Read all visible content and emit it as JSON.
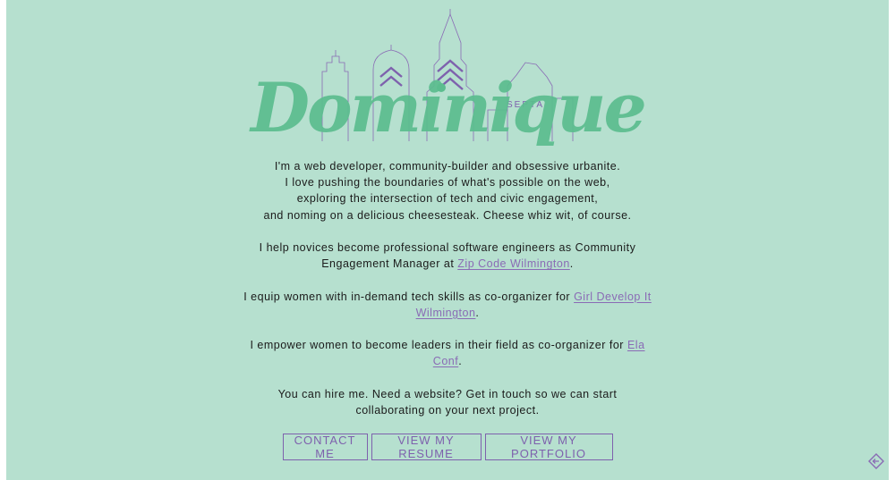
{
  "hero": {
    "title": "Dominique",
    "skyline_sign": "SEPTA"
  },
  "intro": {
    "lines": [
      "I'm a web developer, community-builder and obsessive urbanite.",
      "I love pushing the boundaries of what's possible on the web,",
      "exploring the intersection of tech and civic engagement,",
      "and noming on a delicious cheesesteak. Cheese whiz wit, of course."
    ]
  },
  "roles": [
    {
      "before": "I help novices become professional software engineers as Community Engagement Manager at ",
      "link": "Zip Code Wilmington",
      "after": "."
    },
    {
      "before": "I equip women with in-demand tech skills as co-organizer for ",
      "link": "Girl Develop It Wilmington",
      "after": "."
    },
    {
      "before": "I empower women to become leaders in their field as co-organizer for ",
      "link": "Ela Conf",
      "after": "."
    }
  ],
  "hire": "You can hire me. Need a website? Get in touch so we can start collaborating on your next project.",
  "buttons": {
    "contact": "CONTACT ME",
    "resume": "VIEW MY RESUME",
    "portfolio": "VIEW MY PORTFOLIO"
  },
  "colors": {
    "background": "#b6e0cf",
    "title": "#5bbd8e",
    "accent": "#7e61ad",
    "text": "#1b1b1b"
  },
  "icons": {
    "skyline": "philadelphia-skyline-icon",
    "corner": "diamond-arrow-icon"
  }
}
